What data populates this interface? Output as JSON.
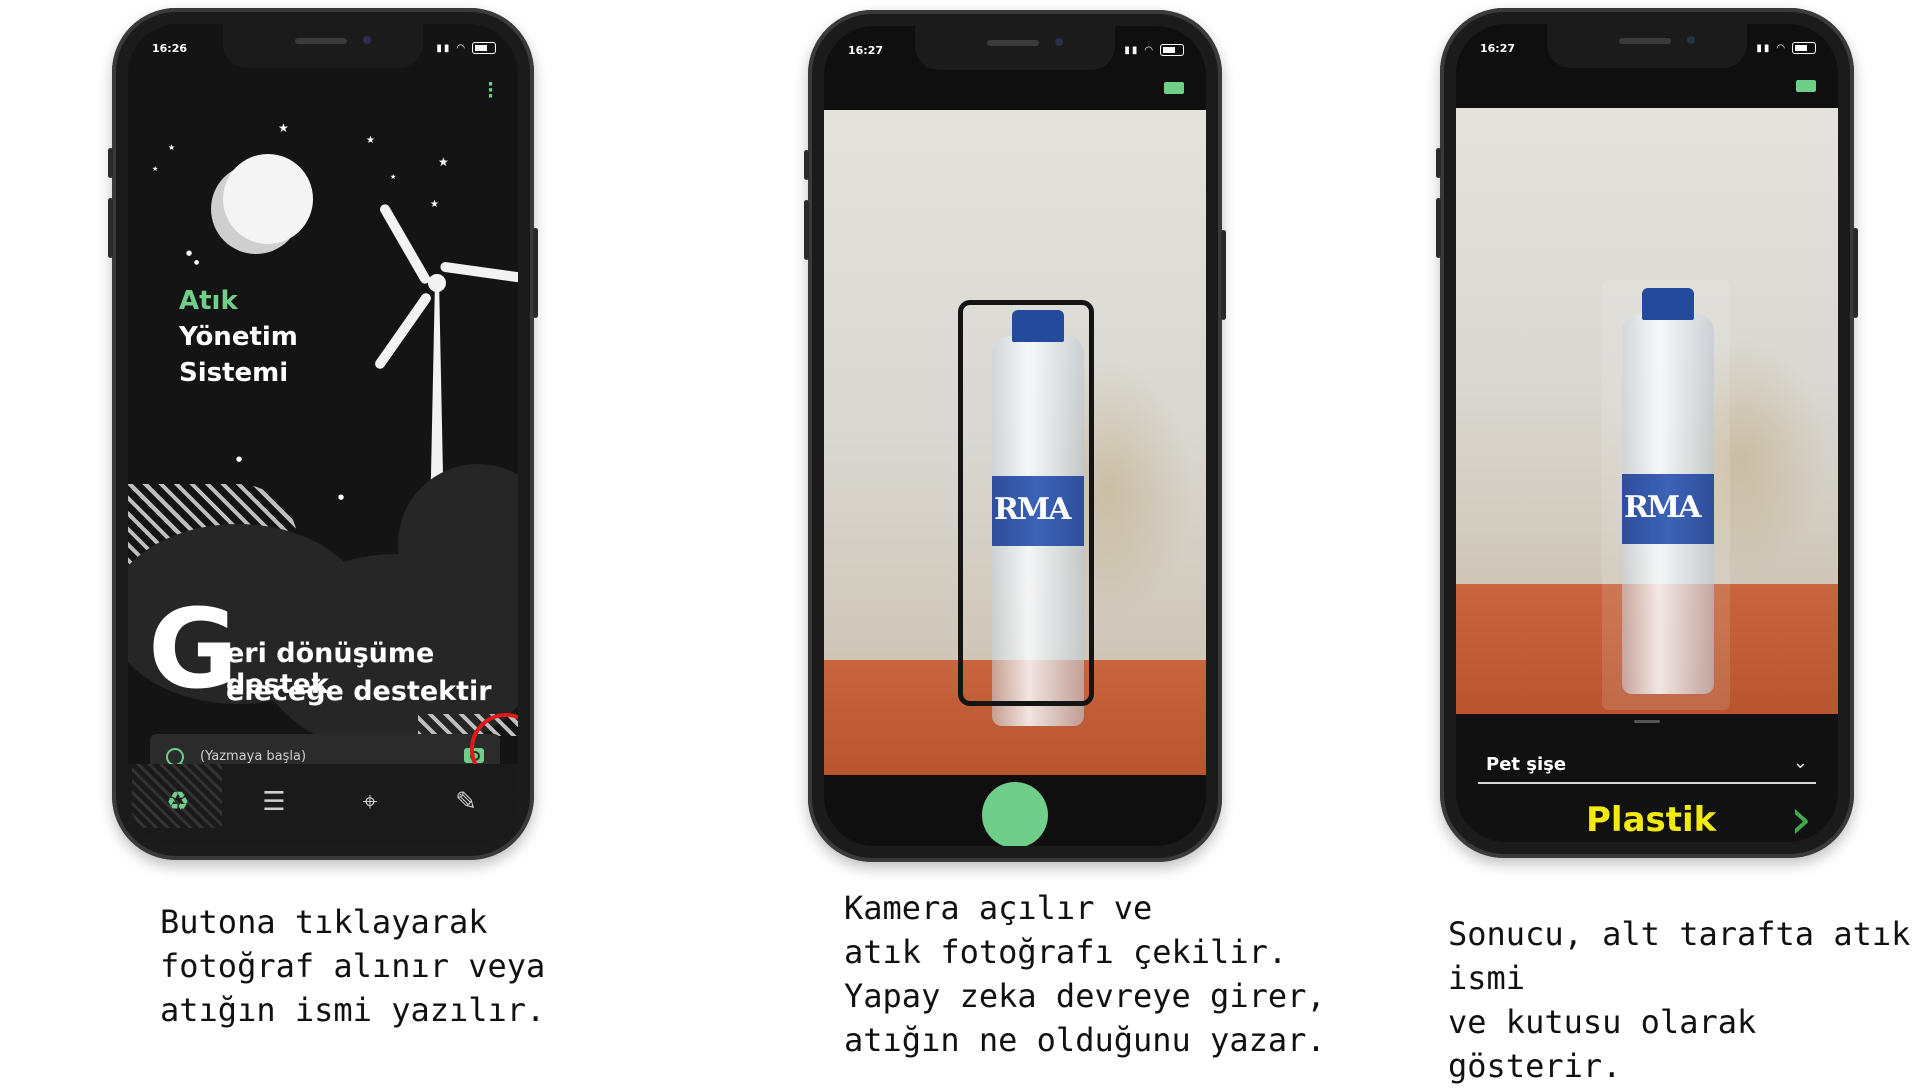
{
  "phone1": {
    "time": "16:26",
    "title_lines": [
      "Atık",
      "Yönetim",
      "Sistemi"
    ],
    "big_letter": "G",
    "slogan_lines": [
      "eri dönüşüme destek",
      "eleceğe destektir"
    ],
    "search_placeholder": "(Yazmaya başla)"
  },
  "phone2": {
    "time": "16:27",
    "bottle_label": "RMA"
  },
  "phone3": {
    "time": "16:27",
    "bottle_label": "RMA",
    "result_name": "Pet şişe",
    "result_category": "Plastik",
    "colors": {
      "category_text": "#f2ea0a",
      "accent_green": "#6fcf8a"
    }
  },
  "captions": {
    "c1": [
      "Butona tıklayarak",
      "fotoğraf alınır veya",
      "atığın ismi yazılır."
    ],
    "c2": [
      "Kamera açılır ve",
      "atık fotoğrafı çekilir.",
      "Yapay zeka devreye girer,",
      "atığın ne olduğunu yazar."
    ],
    "c3": [
      "Sonucu, alt tarafta atık ismi",
      "ve kutusu olarak gösterir."
    ]
  }
}
